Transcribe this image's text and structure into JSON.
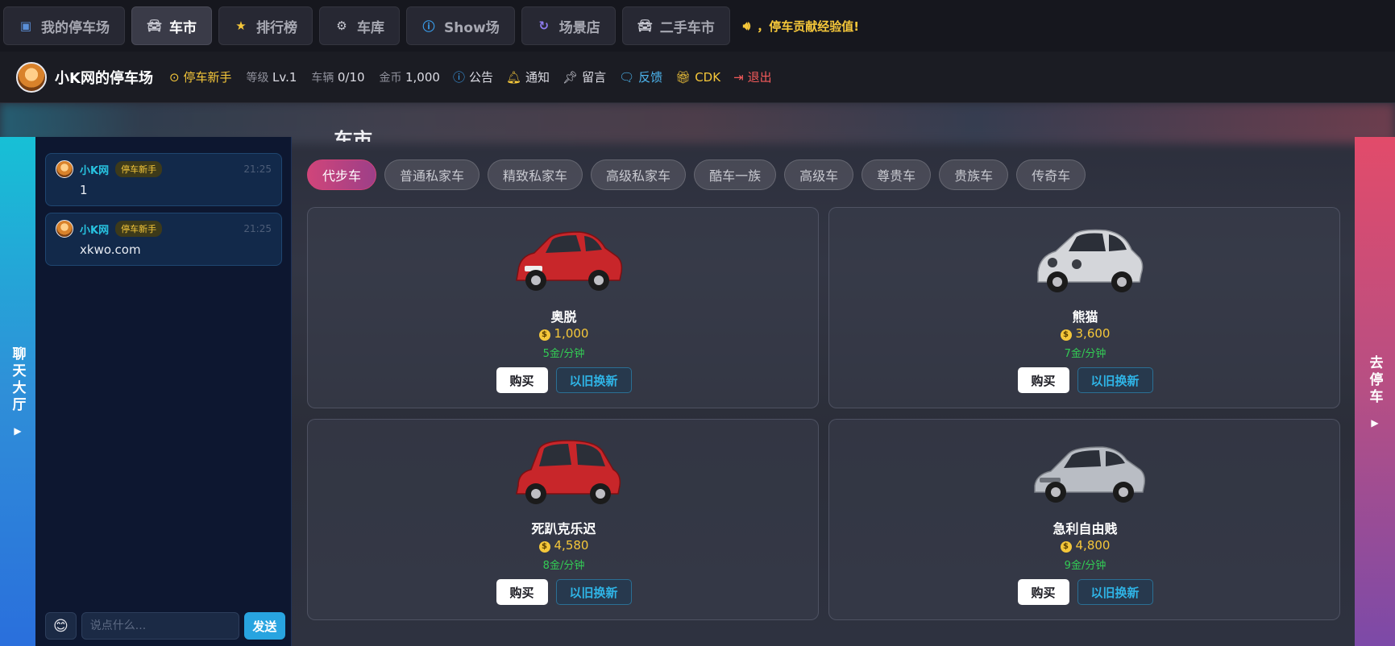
{
  "nav": {
    "items": [
      {
        "label": "我的停车场",
        "icon": "parking-icon",
        "active": false
      },
      {
        "label": "车市",
        "icon": "car-icon",
        "active": true
      },
      {
        "label": "排行榜",
        "icon": "star-icon",
        "active": false
      },
      {
        "label": "车库",
        "icon": "gear-icon",
        "active": false
      },
      {
        "label": "Show场",
        "icon": "info-icon",
        "active": false
      },
      {
        "label": "场景店",
        "icon": "refresh-icon",
        "active": false
      },
      {
        "label": "二手车市",
        "icon": "car-icon",
        "active": false
      }
    ],
    "announcement": "，停车贡献经验值!"
  },
  "status": {
    "site_name": "小K网的停车场",
    "rank": "停车新手",
    "level_label": "等级",
    "level_value": "Lv.1",
    "vehicles_label": "车辆",
    "vehicles_value": "0/10",
    "gold_label": "金币",
    "gold_value": "1,000",
    "links": [
      {
        "label": "公告",
        "icon": "info-icon",
        "color": "#dcdce4"
      },
      {
        "label": "通知",
        "icon": "bell-icon",
        "color": "#dcdce4"
      },
      {
        "label": "留言",
        "icon": "pin-icon",
        "color": "#dcdce4"
      },
      {
        "label": "反馈",
        "icon": "chat-icon",
        "color": "#4db6f0"
      },
      {
        "label": "CDK",
        "icon": "gift-icon",
        "color": "#f5c73a"
      },
      {
        "label": "退出",
        "icon": "logout-icon",
        "color": "#f25a5a"
      }
    ]
  },
  "chat": {
    "tab_label": "聊天大厅",
    "messages": [
      {
        "user": "小K网",
        "badge": "停车新手",
        "time": "21:25",
        "text": "1"
      },
      {
        "user": "小K网",
        "badge": "停车新手",
        "time": "21:25",
        "text": "xkwo.com"
      }
    ],
    "input_placeholder": "说点什么...",
    "send_label": "发送",
    "emoji": "😊"
  },
  "park_tab_label": "去停车",
  "market": {
    "title": "车市",
    "tabs": [
      "代步车",
      "普通私家车",
      "精致私家车",
      "高级私家车",
      "酷车一族",
      "高级车",
      "尊贵车",
      "贵族车",
      "传奇车"
    ],
    "active_tab": 0,
    "cars": [
      {
        "name": "奥脱",
        "price": "1,000",
        "rate": "5金/分钟",
        "color": "#c8262a"
      },
      {
        "name": "熊猫",
        "price": "3,600",
        "rate": "7金/分钟",
        "color": "#d4d6da"
      },
      {
        "name": "死趴克乐迟",
        "price": "4,580",
        "rate": "8金/分钟",
        "color": "#c8262a"
      },
      {
        "name": "急利自由贱",
        "price": "4,800",
        "rate": "9金/分钟",
        "color": "#b9bdc4"
      }
    ],
    "buy_label": "购买",
    "trade_label": "以旧换新"
  },
  "colors": {
    "accent_pink": "#d0457a",
    "gold": "#f5c73a",
    "green": "#33cc55",
    "cyan": "#28a4e0"
  }
}
